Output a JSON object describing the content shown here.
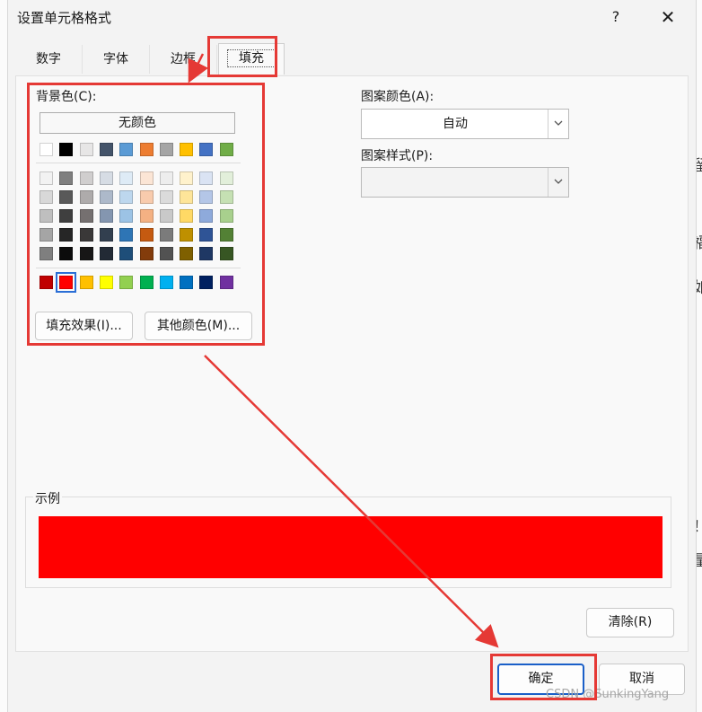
{
  "window": {
    "title": "设置单元格格式",
    "help_label": "?",
    "close_label": "✕"
  },
  "tabs": [
    {
      "label": "数字",
      "active": false
    },
    {
      "label": "字体",
      "active": false
    },
    {
      "label": "边框",
      "active": false
    },
    {
      "label": "填充",
      "active": true
    }
  ],
  "fill": {
    "background_label": "背景色(C):",
    "no_color_label": "无颜色",
    "theme_row": [
      "#ffffff",
      "#000000",
      "#e7e6e6",
      "#44546a",
      "#5b9bd5",
      "#ed7d31",
      "#a5a5a5",
      "#ffc000",
      "#4472c4",
      "#70ad47"
    ],
    "shade_rows": [
      [
        "#f2f2f2",
        "#7f7f7f",
        "#d0cece",
        "#d6dce4",
        "#deebf6",
        "#fbe5d5",
        "#ededed",
        "#fff2cc",
        "#dae3f3",
        "#e2efda"
      ],
      [
        "#d8d8d8",
        "#595959",
        "#aeabab",
        "#adb9ca",
        "#bdd7ee",
        "#f8cbad",
        "#dbdbdb",
        "#fee599",
        "#b4c6e7",
        "#c5e0b3"
      ],
      [
        "#bfbfbf",
        "#3f3f3f",
        "#757070",
        "#8496b0",
        "#9cc3e5",
        "#f4b183",
        "#c9c9c9",
        "#ffd965",
        "#8eaadb",
        "#a8d08d"
      ],
      [
        "#a5a5a5",
        "#262626",
        "#3a3838",
        "#323f4f",
        "#2e75b5",
        "#c55a11",
        "#7b7b7b",
        "#bf9000",
        "#2f5496",
        "#538135"
      ],
      [
        "#7f7f7f",
        "#0c0c0c",
        "#171616",
        "#222a35",
        "#1e4e79",
        "#833c0b",
        "#525252",
        "#7f6000",
        "#1f3864",
        "#375623"
      ]
    ],
    "standard_row": [
      "#c00000",
      "#ff0000",
      "#ffc000",
      "#ffff00",
      "#92d050",
      "#00b050",
      "#00b0f0",
      "#0070c0",
      "#002060",
      "#7030a0"
    ],
    "selected_color": "#ff0000",
    "fill_effects_label": "填充效果(I)...",
    "more_colors_label": "其他颜色(M)...",
    "pattern_color_label": "图案颜色(A):",
    "pattern_color_value": "自动",
    "pattern_style_label": "图案样式(P):",
    "pattern_style_value": "",
    "sample_label": "示例",
    "sample_color": "#ff0000",
    "clear_label": "清除(R)"
  },
  "footer": {
    "ok_label": "确定",
    "cancel_label": "取消"
  },
  "background_glyphs": [
    "留",
    "福",
    "如",
    "！",
    "量"
  ],
  "watermark": "CSDN @SunkingYang",
  "annotation_color": "#e53935"
}
